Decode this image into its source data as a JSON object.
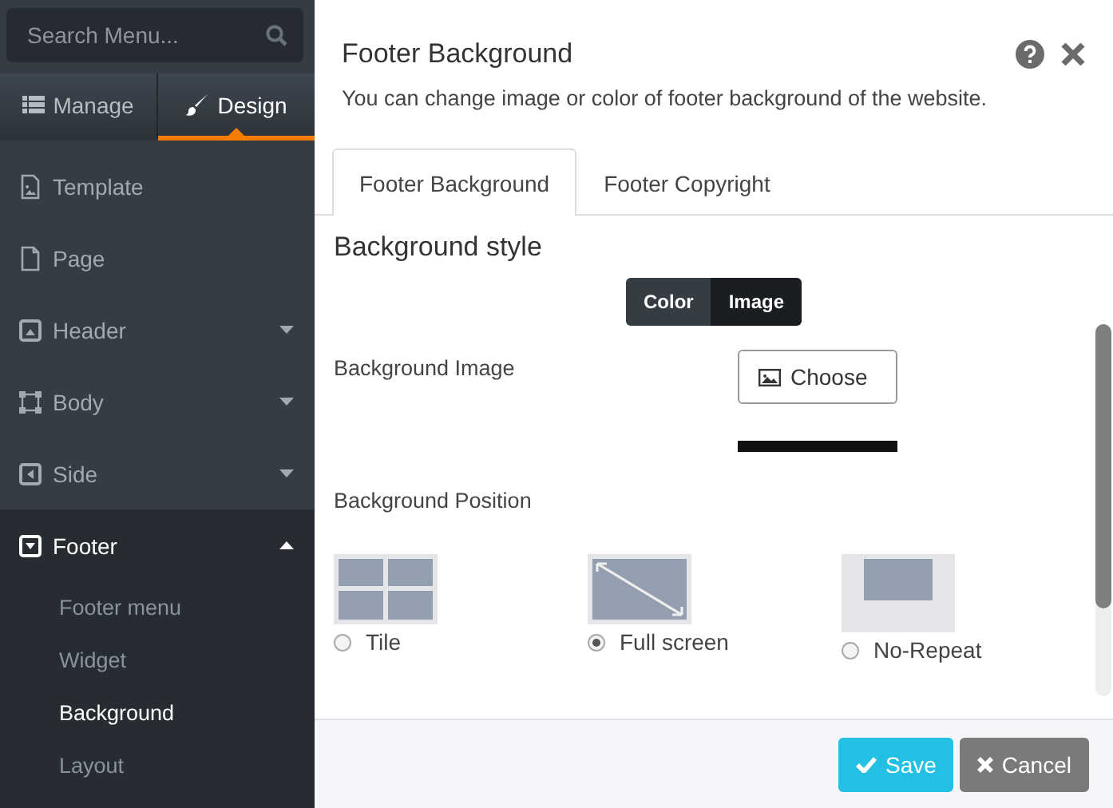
{
  "sidebar": {
    "search": {
      "placeholder": "Search Menu..."
    },
    "tabs": [
      {
        "label": "Manage",
        "selected": false
      },
      {
        "label": "Design",
        "selected": true
      }
    ],
    "items": [
      {
        "kind": "link",
        "label": "Template",
        "selected": false
      },
      {
        "kind": "link",
        "label": "Page",
        "selected": false
      },
      {
        "kind": "group",
        "label": "Header",
        "expanded": false,
        "selected": false
      },
      {
        "kind": "group",
        "label": "Body",
        "expanded": false,
        "selected": false
      },
      {
        "kind": "group",
        "label": "Side",
        "expanded": false,
        "selected": false
      },
      {
        "kind": "group",
        "label": "Footer",
        "expanded": true,
        "selected": true,
        "children": [
          {
            "label": "Footer menu",
            "selected": false
          },
          {
            "label": "Widget",
            "selected": false
          },
          {
            "label": "Background",
            "selected": true
          },
          {
            "label": "Layout",
            "selected": false
          }
        ]
      }
    ]
  },
  "dialog": {
    "title": "Footer Background",
    "description": "You can change image or color of footer background of the website.",
    "tabs": [
      {
        "label": "Footer Background",
        "selected": true
      },
      {
        "label": "Footer Copyright",
        "selected": false
      }
    ],
    "section_title": "Background style",
    "style_toggle": [
      {
        "label": "Color",
        "selected": false
      },
      {
        "label": "Image",
        "selected": true
      }
    ],
    "image_label": "Background Image",
    "choose_button": "Choose",
    "position_label": "Background Position",
    "positions": [
      {
        "kind": "tile",
        "label": "Tile",
        "selected": false
      },
      {
        "kind": "fullscreen",
        "label": "Full screen",
        "selected": true
      },
      {
        "kind": "norepeat",
        "label": "No-Repeat",
        "selected": false
      }
    ],
    "buttons": [
      {
        "kind": "save",
        "label": "Save"
      },
      {
        "kind": "cancel",
        "label": "Cancel"
      }
    ]
  }
}
